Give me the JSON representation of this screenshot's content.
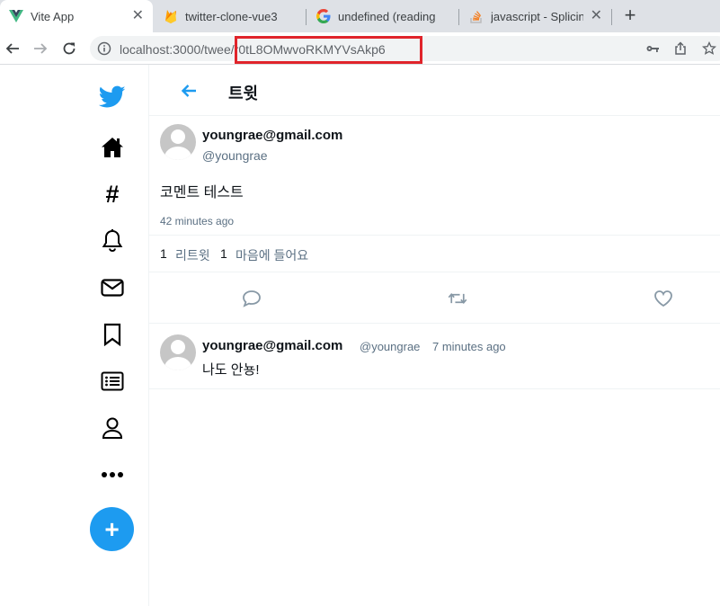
{
  "browser": {
    "tabs": [
      {
        "title": "Vite App",
        "icon": "vue-icon",
        "active": true
      },
      {
        "title": "twitter-clone-vue3",
        "icon": "firebase-icon",
        "active": false
      },
      {
        "title": "undefined (reading",
        "icon": "google-icon",
        "active": false
      },
      {
        "title": "javascript - Splicing",
        "icon": "stackoverflow-icon",
        "active": false
      }
    ],
    "url_base": "localhost:3000/twee",
    "url_highlighted": "/r0tL8OMwvoRKMYVsAkp6",
    "highlight_color": "#e0242b"
  },
  "sidebar": {
    "icons": [
      "twitter-logo-icon",
      "home-icon",
      "hashtag-icon",
      "bell-icon",
      "mail-icon",
      "bookmark-icon",
      "list-icon",
      "profile-icon",
      "more-icon"
    ],
    "compose_label": "+",
    "accent": "#1d9bf0"
  },
  "header": {
    "title": "트윗"
  },
  "tweet": {
    "name": "youngrae@gmail.com",
    "handle": "@youngrae",
    "text": "코멘트 테스트",
    "time": "42 minutes ago",
    "retweet_count": "1",
    "retweet_label": "리트윗",
    "like_count": "1",
    "like_label": "마음에 들어요"
  },
  "comment": {
    "name": "youngrae@gmail.com",
    "handle": "@youngrae",
    "time": "7 minutes ago",
    "text": "나도 안뇽!"
  }
}
